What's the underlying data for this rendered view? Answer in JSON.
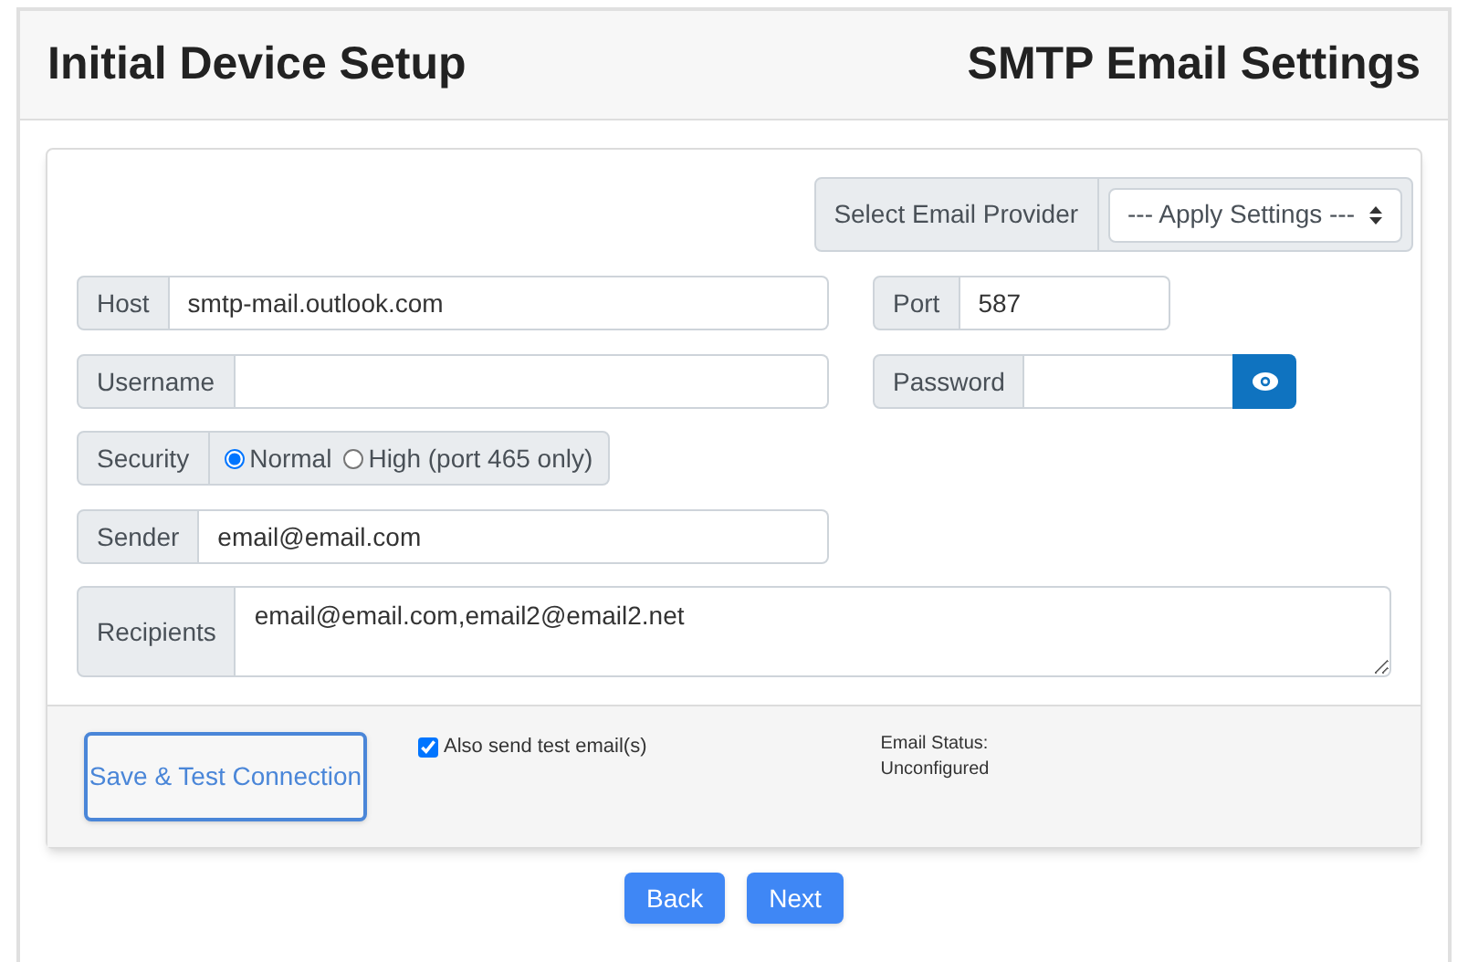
{
  "header": {
    "title": "Initial Device Setup",
    "subtitle": "SMTP Email Settings"
  },
  "provider": {
    "label": "Select Email Provider",
    "value": "--- Apply Settings ---"
  },
  "host": {
    "label": "Host",
    "value": "smtp-mail.outlook.com"
  },
  "port": {
    "label": "Port",
    "value": "587"
  },
  "username": {
    "label": "Username"
  },
  "password": {
    "label": "Password"
  },
  "security": {
    "label": "Security",
    "options": [
      {
        "label": "Normal",
        "selected": true
      },
      {
        "label": "High (port 465 only)",
        "selected": false
      }
    ]
  },
  "sender": {
    "label": "Sender",
    "value": "email@email.com"
  },
  "recipients": {
    "label": "Recipients",
    "value": "email@email.com,email2@email2.net"
  },
  "footer": {
    "save_button": "Save & Test Connection",
    "test_email": {
      "label": "Also send test email(s)",
      "checked": true
    },
    "status_label": "Email Status:",
    "status_value": "Unconfigured"
  },
  "nav_buttons": [
    "Back",
    "Next"
  ]
}
